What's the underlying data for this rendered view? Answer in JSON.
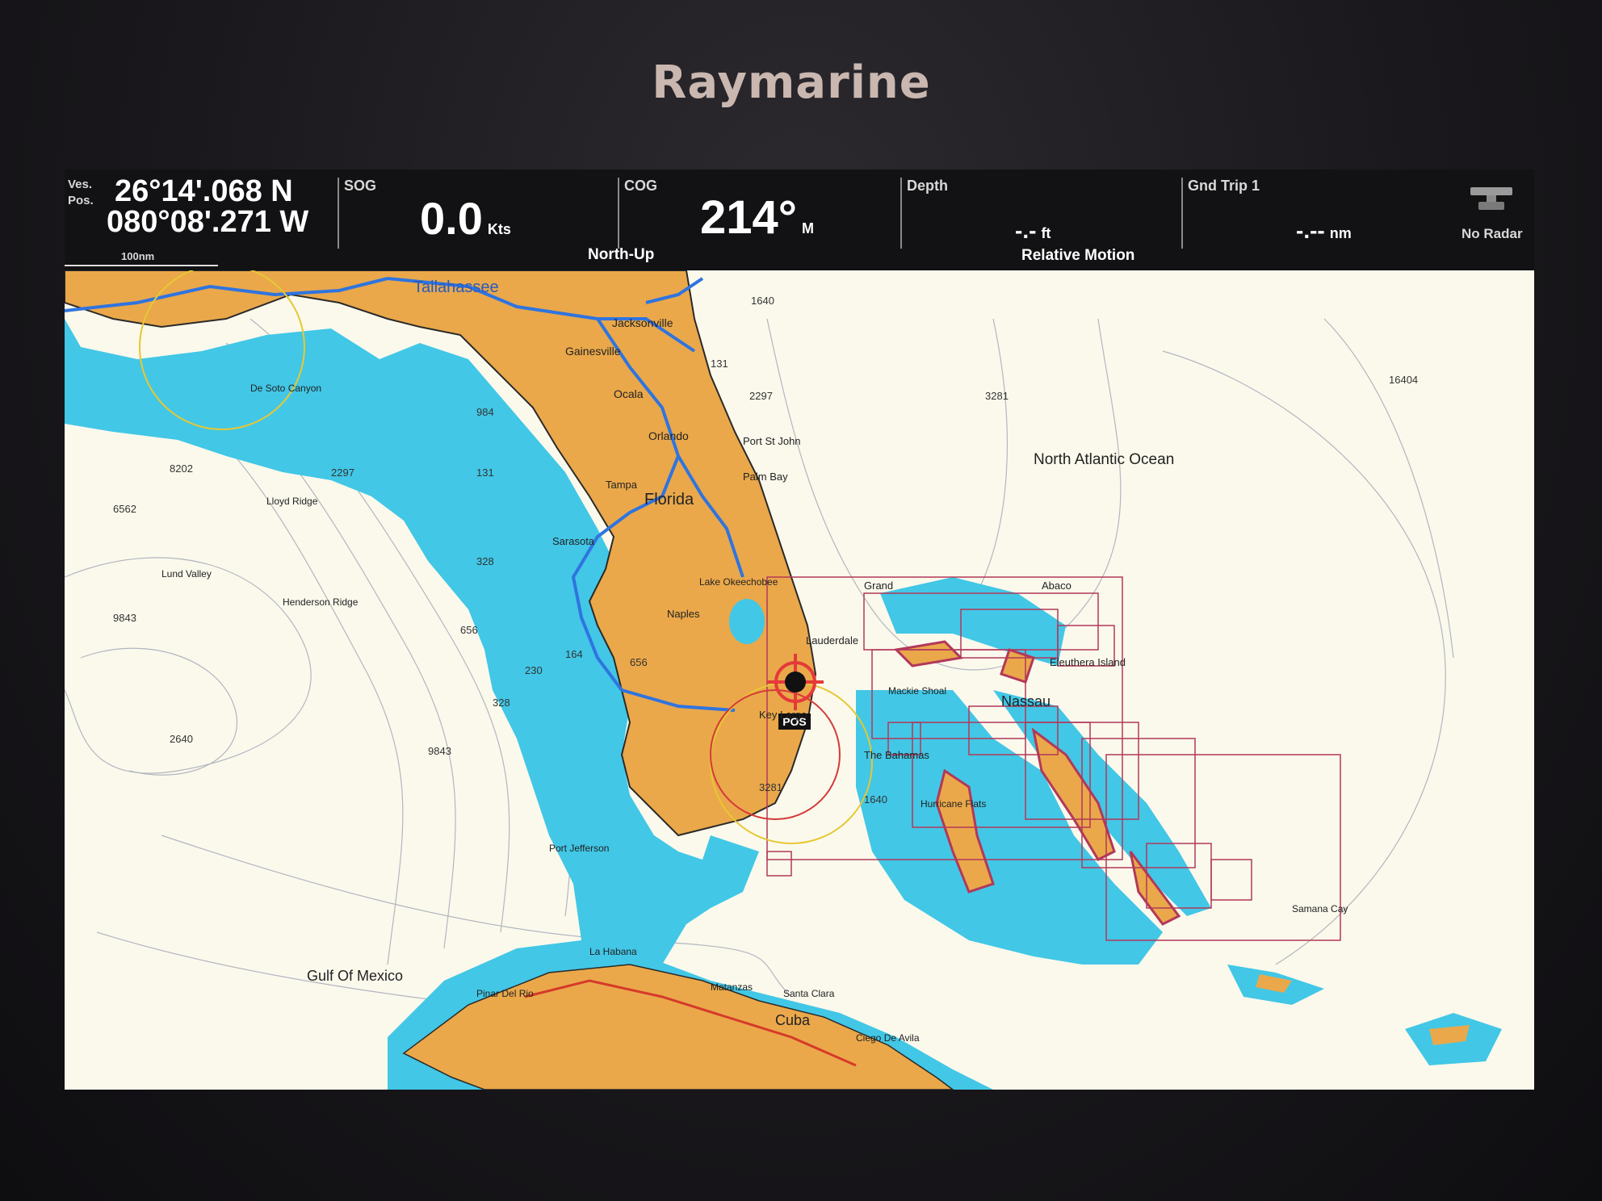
{
  "brand": "Raymarine",
  "databar": {
    "position": {
      "label_line1": "Ves.",
      "label_line2": "Pos.",
      "lat": "26°14'.068 N",
      "lon": "080°08'.271 W",
      "scale": "100nm"
    },
    "sog": {
      "label": "SOG",
      "value": "0.0",
      "unit": "Kts"
    },
    "cog": {
      "label": "COG",
      "value": "214°",
      "unit": "M",
      "mode": "North-Up"
    },
    "depth": {
      "label": "Depth",
      "value": "-.-",
      "unit": "ft",
      "mode": "Relative Motion"
    },
    "trip": {
      "label": "Gnd Trip 1",
      "value": "-.--",
      "unit": "nm"
    },
    "radar": {
      "label": "No Radar",
      "icon": "radar-icon"
    }
  },
  "map": {
    "labels": {
      "tallahassee": "Tallahassee",
      "jacksonville": "Jacksonville",
      "gainesville": "Gainesville",
      "ocala": "Ocala",
      "orlando": "Orlando",
      "florida": "Florida",
      "port_st_john": "Port St John",
      "palm_bay": "Palm Bay",
      "sarasota": "Sarasota",
      "tampa": "Tampa",
      "naples": "Naples",
      "lake_okeechobee": "Lake Okeechobee",
      "lauderdale": "Lauderdale",
      "key_largo": "Key Largo",
      "de_soto_canyon": "De Soto Canyon",
      "lloyd_ridge": "Lloyd Ridge",
      "lund_valley": "Lund Valley",
      "henderson_ridge": "Henderson Ridge",
      "gulf_of_mexico": "Gulf Of Mexico",
      "port_jefferson": "Port Jefferson",
      "north_atlantic": "North Atlantic Ocean",
      "nassau": "Nassau",
      "eleuthera": "Eleuthera Island",
      "abaco": "Abaco",
      "grand": "Grand",
      "mackie_shoal": "Mackie Shoal",
      "the_bahamas": "The Bahamas",
      "hurricane_flats": "Hurricane Flats",
      "cuba": "Cuba",
      "la_habana": "La Habana",
      "pinar_del_rio": "Pinar Del Rio",
      "matanzas": "Matanzas",
      "santa_clara": "Santa Clara",
      "ciego_de_avila": "Ciego De Avila",
      "samana_cay": "Samana Cay",
      "pos": "POS"
    },
    "depths": [
      "1640",
      "131",
      "2297",
      "3281",
      "16404",
      "984",
      "8202",
      "6562",
      "2297",
      "131",
      "328",
      "656",
      "164",
      "230",
      "9843",
      "328",
      "9843",
      "2640",
      "3281",
      "1640",
      "656"
    ]
  },
  "colors": {
    "land": "#eaa84a",
    "shallow": "#42c7e6",
    "sea": "#fbf9ec",
    "route": "#2f74e0",
    "chart_box": "#b2385a"
  }
}
